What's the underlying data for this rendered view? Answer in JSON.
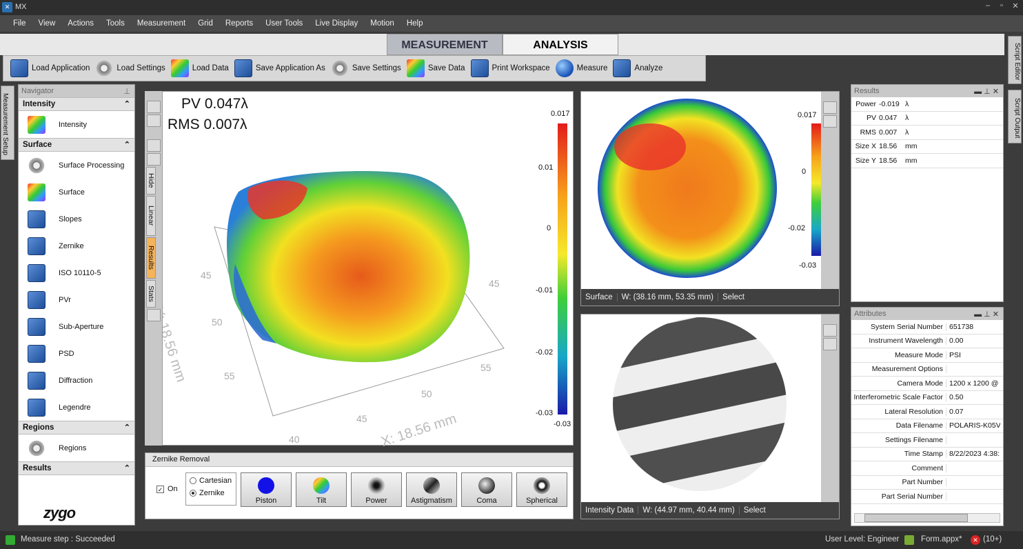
{
  "window": {
    "title": "MX"
  },
  "menu": [
    "File",
    "View",
    "Actions",
    "Tools",
    "Measurement",
    "Grid",
    "Reports",
    "User Tools",
    "Live Display",
    "Motion",
    "Help"
  ],
  "mode_tabs": {
    "measurement": "MEASUREMENT",
    "analysis": "ANALYSIS"
  },
  "toolbar": [
    "Load Application",
    "Load Settings",
    "Load Data",
    "Save Application As",
    "Save Settings",
    "Save Data",
    "Print Workspace",
    "Measure",
    "Analyze"
  ],
  "right_tabs": {
    "script_editor": "Script Editor",
    "script_output": "Script Output"
  },
  "left_tab": "Measurement Setup",
  "navigator": {
    "title": "Navigator",
    "sections": [
      {
        "name": "Intensity",
        "items": [
          "Intensity"
        ]
      },
      {
        "name": "Surface",
        "items": [
          "Surface Processing",
          "Surface",
          "Slopes",
          "Zernike",
          "ISO 10110-5",
          "PVr",
          "Sub-Aperture",
          "PSD",
          "Diffraction",
          "Legendre"
        ]
      },
      {
        "name": "Regions",
        "items": [
          "Regions"
        ]
      },
      {
        "name": "Results",
        "items": []
      }
    ],
    "logo": "zygo"
  },
  "plot3d": {
    "pv": "PV 0.047λ",
    "rms": "RMS 0.007λ",
    "colorbar_ticks": [
      "0.017",
      "0.01",
      "0",
      "-0.01",
      "-0.02",
      "-0.03",
      "-0.03"
    ],
    "axis_y_label": "Y: 18.56 mm",
    "axis_x_label": "X: 18.56 mm",
    "axis_ticks": [
      "45",
      "50",
      "55",
      "40",
      "45",
      "50",
      "55",
      "45"
    ],
    "side_tabs": [
      "Hide",
      "Linear",
      "Results",
      "Stats"
    ]
  },
  "surface_map": {
    "colorbar_ticks": [
      "0.017",
      "0",
      "-0.02",
      "-0.03"
    ],
    "status": [
      "Surface",
      "W: (38.16 mm, 53.35 mm)",
      "Select"
    ]
  },
  "intensity_map": {
    "status": [
      "Intensity Data",
      "W: (44.97 mm, 40.44 mm)",
      "Select"
    ]
  },
  "zernike": {
    "title": "Zernike Removal",
    "on_label": "On",
    "modes": [
      "Cartesian",
      "Zernike"
    ],
    "terms": [
      "Piston",
      "Tilt",
      "Power",
      "Astigmatism",
      "Coma",
      "Spherical"
    ]
  },
  "results": {
    "title": "Results",
    "rows": [
      {
        "name": "Power",
        "value": "-0.019",
        "unit": "λ"
      },
      {
        "name": "PV",
        "value": "0.047",
        "unit": "λ"
      },
      {
        "name": "RMS",
        "value": "0.007",
        "unit": "λ"
      },
      {
        "name": "Size X",
        "value": "18.56",
        "unit": "mm"
      },
      {
        "name": "Size Y",
        "value": "18.56",
        "unit": "mm"
      }
    ]
  },
  "attributes": {
    "title": "Attributes",
    "rows": [
      {
        "name": "System Serial Number",
        "value": "651738"
      },
      {
        "name": "Instrument Wavelength",
        "value": "0.00"
      },
      {
        "name": "Measure Mode",
        "value": "PSI"
      },
      {
        "name": "Measurement Options",
        "value": ""
      },
      {
        "name": "Camera Mode",
        "value": "1200 x 1200 @"
      },
      {
        "name": "Interferometric Scale Factor",
        "value": "0.50"
      },
      {
        "name": "Lateral Resolution",
        "value": "0.07"
      },
      {
        "name": "Data Filename",
        "value": "POLARIS-K05VS"
      },
      {
        "name": "Settings Filename",
        "value": ""
      },
      {
        "name": "Time Stamp",
        "value": "8/22/2023 4:38:"
      },
      {
        "name": "Comment",
        "value": ""
      },
      {
        "name": "Part Number",
        "value": ""
      },
      {
        "name": "Part Serial Number",
        "value": ""
      }
    ]
  },
  "statusbar": {
    "left": "Measure step : Succeeded",
    "user_level": "User Level: Engineer",
    "form": "Form.appx*",
    "alerts": "(10+)"
  }
}
